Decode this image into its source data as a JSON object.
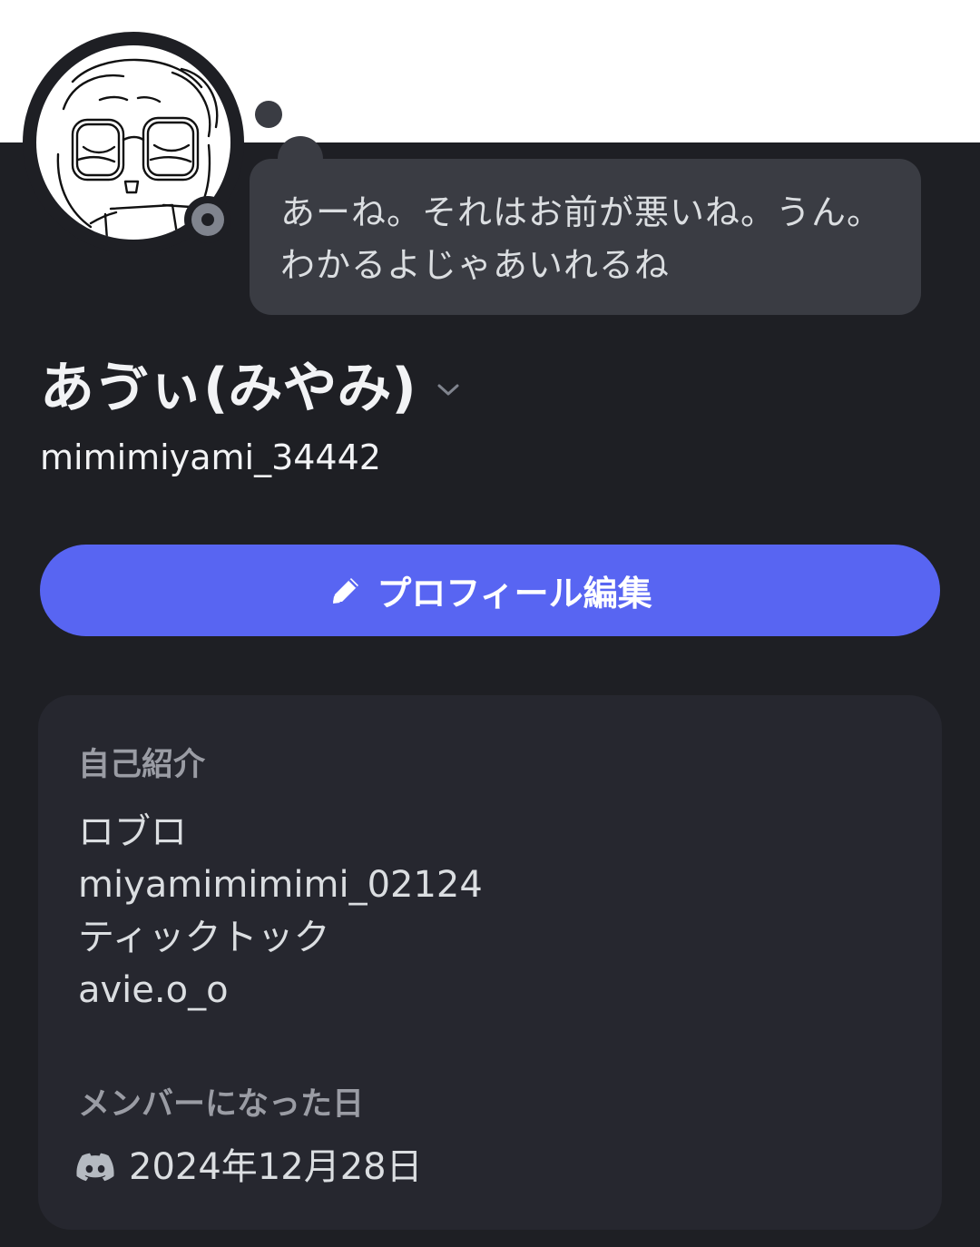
{
  "status_bubble": {
    "text": "あーね。それはお前が悪いね。うん。わかるよじゃあいれるね"
  },
  "profile": {
    "display_name": "あゔぃ(みやみ)",
    "username": "mimimiyami_34442",
    "status": "offline"
  },
  "actions": {
    "edit_profile_label": "プロフィール編集"
  },
  "about": {
    "title": "自己紹介",
    "bio_lines": [
      "ロブロ",
      "miyamimimimi_02124",
      "ティックトック",
      "avie.o_o"
    ]
  },
  "member_since": {
    "title": "メンバーになった日",
    "date": "2024年12月28日"
  },
  "colors": {
    "background": "#1e1f24",
    "banner": "#ffffff",
    "accent": "#5865f2",
    "card": "#26272f",
    "bubble": "#3a3c43"
  },
  "icons": {
    "edit": "pencil-icon",
    "expand": "chevron-down-icon",
    "member_since": "discord-icon"
  }
}
